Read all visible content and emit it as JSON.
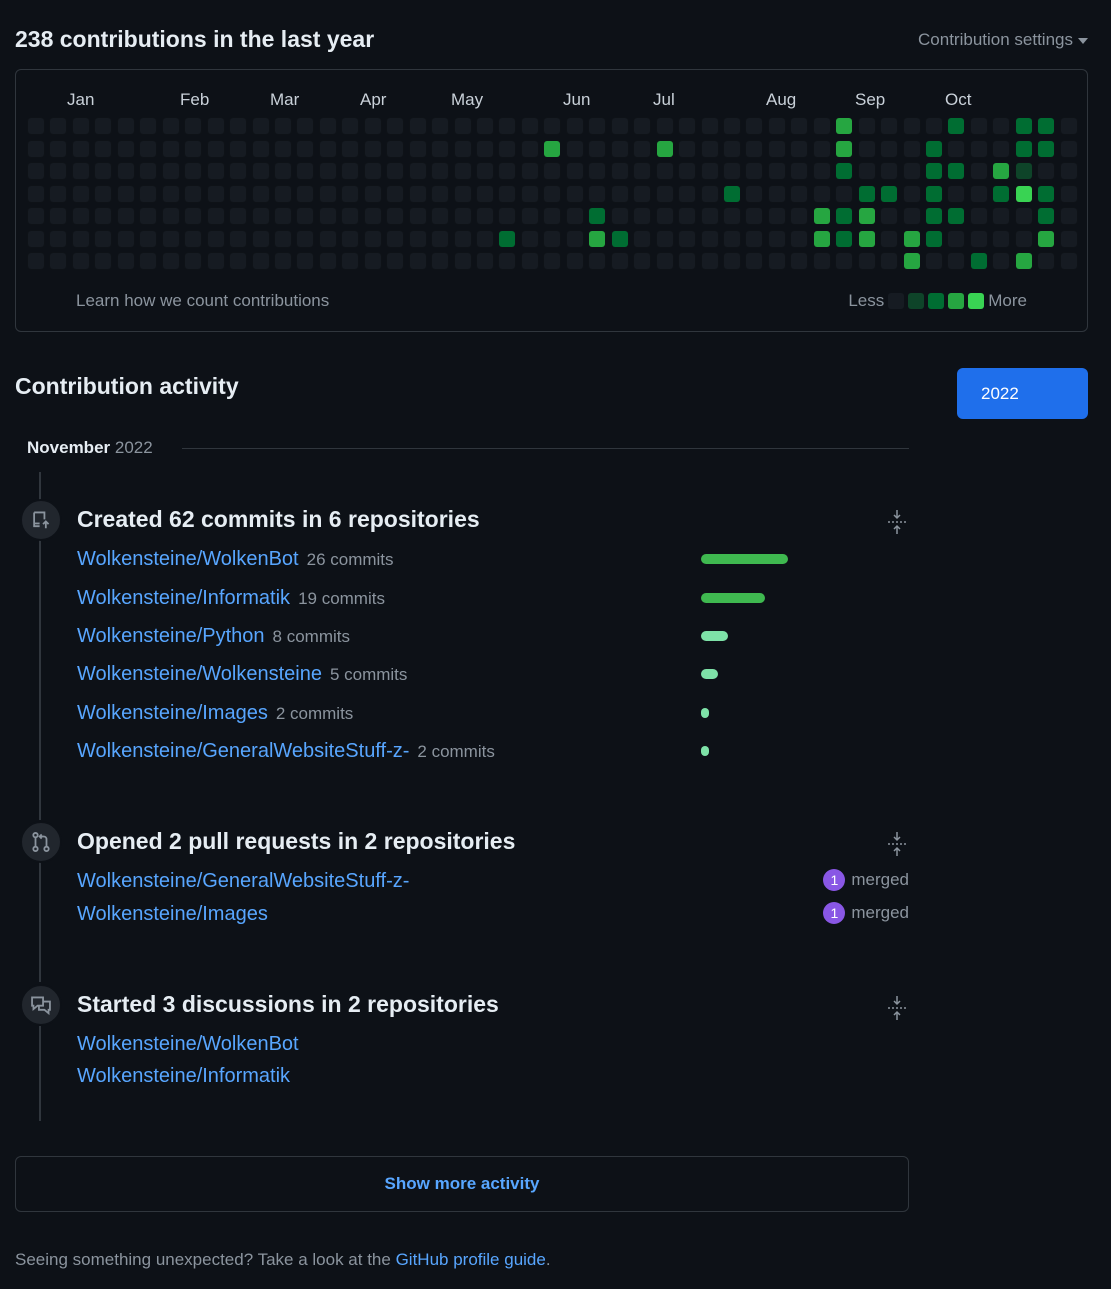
{
  "header": {
    "title": "238 contributions in the last year",
    "settings_label": "Contribution settings"
  },
  "graph": {
    "months": [
      "Jan",
      "Feb",
      "Mar",
      "Apr",
      "May",
      "Jun",
      "Jul",
      "Aug",
      "Sep",
      "Oct"
    ],
    "learn_link": "Learn how we count contributions",
    "legend_less": "Less",
    "legend_more": "More",
    "colors": [
      "#161b22",
      "#0e4429",
      "#006d32",
      "#26a641",
      "#39d353"
    ],
    "active_cells": [
      {
        "week": 21,
        "day": 5,
        "level": 2
      },
      {
        "week": 23,
        "day": 1,
        "level": 3
      },
      {
        "week": 25,
        "day": 4,
        "level": 2
      },
      {
        "week": 25,
        "day": 5,
        "level": 3
      },
      {
        "week": 26,
        "day": 5,
        "level": 2
      },
      {
        "week": 28,
        "day": 1,
        "level": 3
      },
      {
        "week": 31,
        "day": 3,
        "level": 2
      },
      {
        "week": 35,
        "day": 4,
        "level": 3
      },
      {
        "week": 35,
        "day": 5,
        "level": 3
      },
      {
        "week": 36,
        "day": 0,
        "level": 3
      },
      {
        "week": 36,
        "day": 1,
        "level": 3
      },
      {
        "week": 36,
        "day": 2,
        "level": 2
      },
      {
        "week": 36,
        "day": 4,
        "level": 2
      },
      {
        "week": 36,
        "day": 5,
        "level": 2
      },
      {
        "week": 37,
        "day": 3,
        "level": 2
      },
      {
        "week": 37,
        "day": 4,
        "level": 3
      },
      {
        "week": 37,
        "day": 5,
        "level": 3
      },
      {
        "week": 38,
        "day": 3,
        "level": 2
      },
      {
        "week": 39,
        "day": 5,
        "level": 3
      },
      {
        "week": 39,
        "day": 6,
        "level": 3
      },
      {
        "week": 40,
        "day": 1,
        "level": 2
      },
      {
        "week": 40,
        "day": 2,
        "level": 2
      },
      {
        "week": 40,
        "day": 3,
        "level": 2
      },
      {
        "week": 40,
        "day": 4,
        "level": 2
      },
      {
        "week": 40,
        "day": 5,
        "level": 2
      },
      {
        "week": 41,
        "day": 0,
        "level": 2
      },
      {
        "week": 41,
        "day": 2,
        "level": 2
      },
      {
        "week": 41,
        "day": 4,
        "level": 2
      },
      {
        "week": 42,
        "day": 6,
        "level": 2
      },
      {
        "week": 43,
        "day": 2,
        "level": 3
      },
      {
        "week": 43,
        "day": 3,
        "level": 2
      },
      {
        "week": 44,
        "day": 0,
        "level": 2
      },
      {
        "week": 44,
        "day": 1,
        "level": 2
      },
      {
        "week": 44,
        "day": 2,
        "level": 1
      },
      {
        "week": 44,
        "day": 3,
        "level": 4
      },
      {
        "week": 44,
        "day": 6,
        "level": 3
      },
      {
        "week": 45,
        "day": 0,
        "level": 2
      },
      {
        "week": 45,
        "day": 1,
        "level": 2
      },
      {
        "week": 45,
        "day": 3,
        "level": 2
      },
      {
        "week": 45,
        "day": 4,
        "level": 2
      },
      {
        "week": 45,
        "day": 5,
        "level": 3
      }
    ]
  },
  "activity": {
    "title": "Contribution activity",
    "year_button": "2022",
    "month": "November",
    "year": "2022",
    "commits": {
      "title": "Created 62 commits in 6 repositories",
      "repos": [
        {
          "name": "Wolkensteine/WolkenBot",
          "count": "26 commits",
          "commits": 26
        },
        {
          "name": "Wolkensteine/Informatik",
          "count": "19 commits",
          "commits": 19
        },
        {
          "name": "Wolkensteine/Python",
          "count": "8 commits",
          "commits": 8
        },
        {
          "name": "Wolkensteine/Wolkensteine",
          "count": "5 commits",
          "commits": 5
        },
        {
          "name": "Wolkensteine/Images",
          "count": "2 commits",
          "commits": 2
        },
        {
          "name": "Wolkensteine/GeneralWebsiteStuff-z-",
          "count": "2 commits",
          "commits": 2
        }
      ]
    },
    "pulls": {
      "title": "Opened 2 pull requests in 2 repositories",
      "repos": [
        {
          "name": "Wolkensteine/GeneralWebsiteStuff-z-",
          "badge": "1",
          "status": "merged"
        },
        {
          "name": "Wolkensteine/Images",
          "badge": "1",
          "status": "merged"
        }
      ]
    },
    "discussions": {
      "title": "Started 3 discussions in 2 repositories",
      "repos": [
        {
          "name": "Wolkensteine/WolkenBot"
        },
        {
          "name": "Wolkensteine/Informatik"
        }
      ]
    },
    "show_more": "Show more activity"
  },
  "footer": {
    "prefix": "Seeing something unexpected? Take a look at the ",
    "link": "GitHub profile guide",
    "suffix": "."
  }
}
